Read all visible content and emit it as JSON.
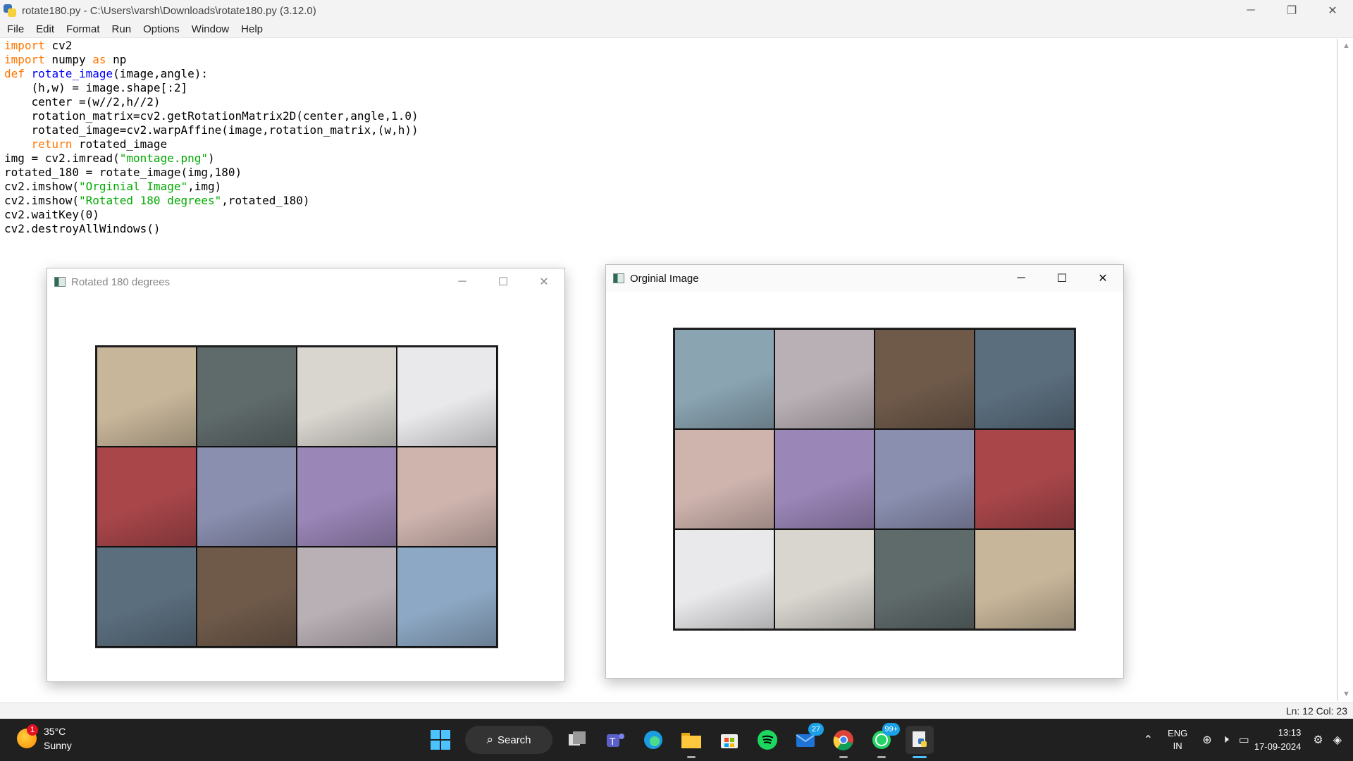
{
  "window": {
    "title": "rotate180.py - C:\\Users\\varsh\\Downloads\\rotate180.py (3.12.0)",
    "minimize": "─",
    "restore": "❐",
    "close": "✕"
  },
  "menu": [
    "File",
    "Edit",
    "Format",
    "Run",
    "Options",
    "Window",
    "Help"
  ],
  "code_lines": [
    [
      {
        "t": "kw",
        "v": "import"
      },
      {
        "t": "p",
        "v": " cv2"
      }
    ],
    [
      {
        "t": "kw",
        "v": "import"
      },
      {
        "t": "p",
        "v": " numpy "
      },
      {
        "t": "kw",
        "v": "as"
      },
      {
        "t": "p",
        "v": " np"
      }
    ],
    [
      {
        "t": "kw",
        "v": "def"
      },
      {
        "t": "p",
        "v": " "
      },
      {
        "t": "fn",
        "v": "rotate_image"
      },
      {
        "t": "p",
        "v": "(image,angle):"
      }
    ],
    [
      {
        "t": "p",
        "v": "    (h,w) = image.shape[:2]"
      }
    ],
    [
      {
        "t": "p",
        "v": "    center =(w//2,h//2)"
      }
    ],
    [
      {
        "t": "p",
        "v": "    rotation_matrix=cv2.getRotationMatrix2D(center,angle,1.0)"
      }
    ],
    [
      {
        "t": "p",
        "v": "    rotated_image=cv2.warpAffine(image,rotation_matrix,(w,h))"
      }
    ],
    [
      {
        "t": "p",
        "v": "    "
      },
      {
        "t": "kw",
        "v": "return"
      },
      {
        "t": "p",
        "v": " rotated_image"
      }
    ],
    [
      {
        "t": "p",
        "v": "img = cv2.imread("
      },
      {
        "t": "st",
        "v": "\"montage.png\""
      },
      {
        "t": "p",
        "v": ")"
      }
    ],
    [
      {
        "t": "p",
        "v": "rotated_180 = rotate_image(img,180)"
      }
    ],
    [
      {
        "t": "p",
        "v": "cv2.imshow("
      },
      {
        "t": "st",
        "v": "\"Orginial Image\""
      },
      {
        "t": "p",
        "v": ",img)"
      }
    ],
    [
      {
        "t": "p",
        "v": "cv2.imshow("
      },
      {
        "t": "st",
        "v": "\"Rotated 180 degrees\""
      },
      {
        "t": "p",
        "v": ",rotated_180)"
      }
    ],
    [
      {
        "t": "p",
        "v": "cv2.waitKey(0)"
      }
    ],
    [
      {
        "t": "p",
        "v": "cv2.destroyAllWindows()"
      }
    ]
  ],
  "status": {
    "position": "Ln: 12   Col: 23"
  },
  "rotated_window": {
    "title": "Rotated 180 degrees",
    "tiles": [
      "#c8b69a",
      "#5f6a6a",
      "#d9d6d0",
      "#e9e8ea",
      "#a8464a",
      "#8a8fb0",
      "#9b86b8",
      "#cfb4ae",
      "#5b6e7e",
      "#6f5a4a",
      "#b9b0b5",
      "#8da8c4"
    ]
  },
  "original_window": {
    "title": "Orginial Image",
    "tiles": [
      "#8aa4b2",
      "#b9b0b5",
      "#6f5a4a",
      "#5b6e7e",
      "#cfb4ae",
      "#9b86b8",
      "#8a8fb0",
      "#a8464a",
      "#e9e8ea",
      "#d9d6d0",
      "#5f6a6a",
      "#c8b69a"
    ]
  },
  "taskbar": {
    "weather_temp": "35°C",
    "weather_desc": "Sunny",
    "weather_badge": "1",
    "search_label": "Search",
    "teams_badge": "27",
    "whatsapp_badge": "99+",
    "lang_top": "ENG",
    "lang_bottom": "IN",
    "time": "13:13",
    "date": "17-09-2024"
  },
  "colors": {
    "keyword": "#ff7700",
    "function": "#0000ff",
    "string": "#00aa00",
    "taskbar": "#202020"
  }
}
